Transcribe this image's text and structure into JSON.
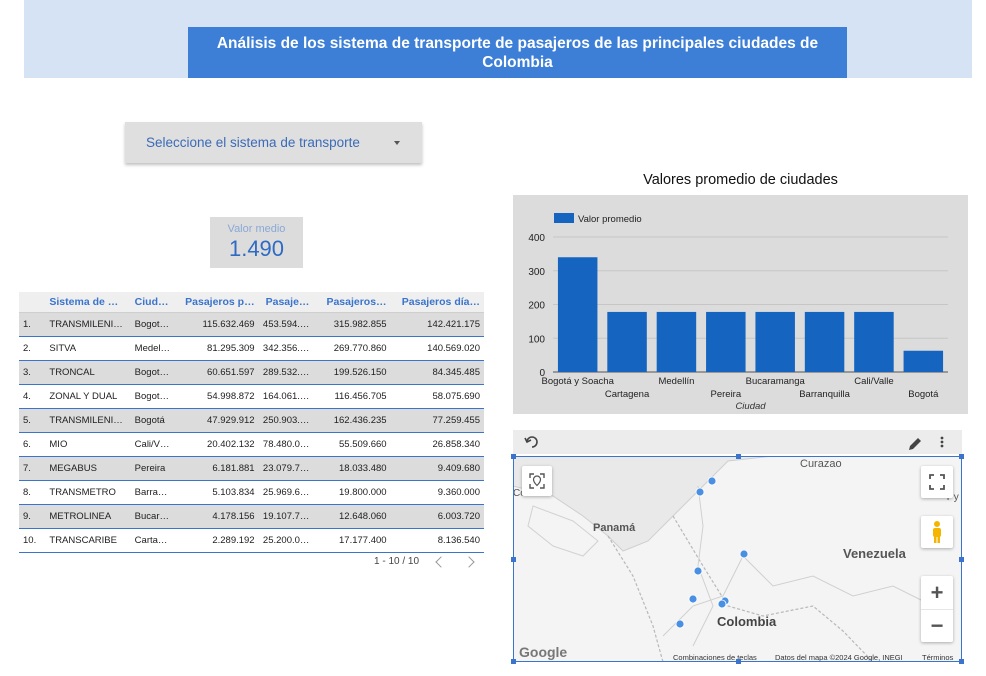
{
  "header": {
    "title": "Análisis de los sistema de transporte de pasajeros de las principales ciudades de Colombia"
  },
  "filter": {
    "label": "Seleccione el sistema de transporte"
  },
  "scorecard": {
    "label": "Valor medio",
    "value": "1.490"
  },
  "table": {
    "columns": [
      "Sistema de …",
      "Ciud…",
      "Pasajeros p…",
      "Pasaje…",
      "Pasajeros…",
      "Pasajeros día…"
    ],
    "rows": [
      {
        "n": "1.",
        "sistema": "TRANSMILENI…",
        "ciudad": "Bogot…",
        "c1": "115.632.469",
        "c2": "453.594.…",
        "c3": "315.982.855",
        "c4": "142.421.175"
      },
      {
        "n": "2.",
        "sistema": "SITVA",
        "ciudad": "Medel…",
        "c1": "81.295.309",
        "c2": "342.356.…",
        "c3": "269.770.860",
        "c4": "140.569.020"
      },
      {
        "n": "3.",
        "sistema": "TRONCAL",
        "ciudad": "Bogot…",
        "c1": "60.651.597",
        "c2": "289.532.…",
        "c3": "199.526.150",
        "c4": "84.345.485"
      },
      {
        "n": "4.",
        "sistema": "ZONAL Y DUAL",
        "ciudad": "Bogot…",
        "c1": "54.998.872",
        "c2": "164.061.…",
        "c3": "116.456.705",
        "c4": "58.075.690"
      },
      {
        "n": "5.",
        "sistema": "TRANSMILENI…",
        "ciudad": "Bogotá",
        "c1": "47.929.912",
        "c2": "250.903.…",
        "c3": "162.436.235",
        "c4": "77.259.455"
      },
      {
        "n": "6.",
        "sistema": "MIO",
        "ciudad": "Cali/V…",
        "c1": "20.402.132",
        "c2": "78.480.0…",
        "c3": "55.509.660",
        "c4": "26.858.340"
      },
      {
        "n": "7.",
        "sistema": "MEGABUS",
        "ciudad": "Pereira",
        "c1": "6.181.881",
        "c2": "23.079.7…",
        "c3": "18.033.480",
        "c4": "9.409.680"
      },
      {
        "n": "8.",
        "sistema": "TRANSMETRO",
        "ciudad": "Barra…",
        "c1": "5.103.834",
        "c2": "25.969.6…",
        "c3": "19.800.000",
        "c4": "9.360.000"
      },
      {
        "n": "9.",
        "sistema": "METROLINEA",
        "ciudad": "Bucar…",
        "c1": "4.178.156",
        "c2": "19.107.7…",
        "c3": "12.648.060",
        "c4": "6.003.720"
      },
      {
        "n": "10.",
        "sistema": "TRANSCARIBE",
        "ciudad": "Carta…",
        "c1": "2.289.192",
        "c2": "25.200.0…",
        "c3": "17.177.400",
        "c4": "8.136.540"
      }
    ],
    "pagination": "1 - 10 / 10"
  },
  "chart_data": {
    "type": "bar",
    "title": "Valores promedio de ciudades",
    "xlabel": "Ciudad",
    "ylabel": "",
    "ylim": [
      0,
      400
    ],
    "yticks": [
      "0",
      "100",
      "200",
      "300",
      "400"
    ],
    "categories": [
      "Bogotá y Soacha",
      "Cartagena",
      "Medellín",
      "Pereira",
      "Bucaramanga",
      "Barranquilla",
      "Cali/Valle",
      "Bogotá"
    ],
    "series": [
      {
        "name": "Valor promedio",
        "values": [
          340,
          178,
          178,
          178,
          178,
          178,
          178,
          63
        ]
      }
    ],
    "legend": "top-left",
    "bar_color": "#1565c0"
  },
  "map": {
    "labels": {
      "curazao": "Curazao",
      "panama": "Panamá",
      "venezuela": "Venezuela",
      "colombia": "Colombia",
      "left_edge": "Co    ca",
      "right_edge": "T  y T  o"
    },
    "footer": {
      "google": "Google",
      "shortcuts": "Combinaciones de teclas",
      "data": "Datos del mapa ©2024 Google, INEGI",
      "terms": "Términos"
    },
    "zoom_in": "+",
    "zoom_out": "−",
    "marker_color": "#4a90e2"
  }
}
